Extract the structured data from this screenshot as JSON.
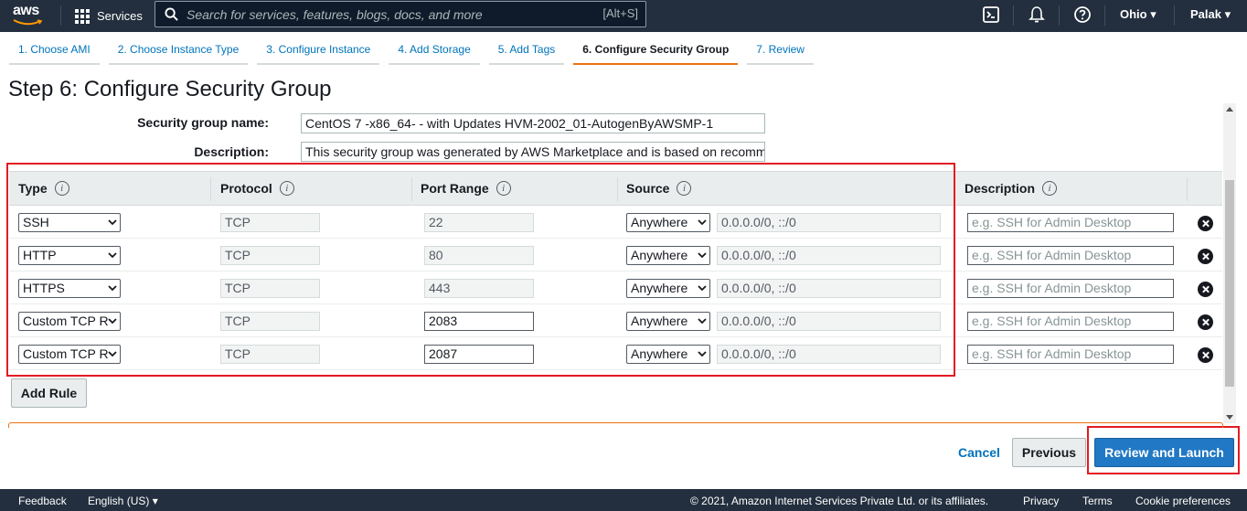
{
  "nav": {
    "logo": "aws",
    "services": "Services",
    "search_placeholder": "Search for services, features, blogs, docs, and more",
    "search_shortcut": "[Alt+S]",
    "region": "Ohio ▾",
    "user": "Palak ▾"
  },
  "steps": [
    {
      "label": "1. Choose AMI"
    },
    {
      "label": "2. Choose Instance Type"
    },
    {
      "label": "3. Configure Instance"
    },
    {
      "label": "4. Add Storage"
    },
    {
      "label": "5. Add Tags"
    },
    {
      "label": "6. Configure Security Group"
    },
    {
      "label": "7. Review"
    }
  ],
  "page_title": "Step 6: Configure Security Group",
  "form": {
    "sg_name_label": "Security group name:",
    "sg_name_value": "CentOS 7 -x86_64- - with Updates HVM-2002_01-AutogenByAWSMP-1",
    "desc_label": "Description:",
    "desc_value": "This security group was generated by AWS Marketplace and is based on recommended settings"
  },
  "table": {
    "headers": {
      "type": "Type",
      "protocol": "Protocol",
      "port_range": "Port Range",
      "source": "Source",
      "description": "Description"
    },
    "info_glyph": "i",
    "rows": [
      {
        "type": "SSH",
        "protocol": "TCP",
        "port": "22",
        "source": "Anywhere",
        "cidr": "0.0.0.0/0, ::/0",
        "desc_placeholder": "e.g. SSH for Admin Desktop"
      },
      {
        "type": "HTTP",
        "protocol": "TCP",
        "port": "80",
        "source": "Anywhere",
        "cidr": "0.0.0.0/0, ::/0",
        "desc_placeholder": "e.g. SSH for Admin Desktop"
      },
      {
        "type": "HTTPS",
        "protocol": "TCP",
        "port": "443",
        "source": "Anywhere",
        "cidr": "0.0.0.0/0, ::/0",
        "desc_placeholder": "e.g. SSH for Admin Desktop"
      },
      {
        "type": "Custom TCP R",
        "protocol": "TCP",
        "port": "2083",
        "source": "Anywhere",
        "cidr": "0.0.0.0/0, ::/0",
        "desc_placeholder": "e.g. SSH for Admin Desktop"
      },
      {
        "type": "Custom TCP R",
        "protocol": "TCP",
        "port": "2087",
        "source": "Anywhere",
        "cidr": "0.0.0.0/0, ::/0",
        "desc_placeholder": "e.g. SSH for Admin Desktop"
      }
    ]
  },
  "buttons": {
    "add_rule": "Add Rule",
    "cancel": "Cancel",
    "previous": "Previous",
    "review_launch": "Review and Launch"
  },
  "footer": {
    "feedback": "Feedback",
    "language": "English (US) ▾",
    "copyright": "© 2021, Amazon Internet Services Private Ltd. or its affiliates.",
    "privacy": "Privacy",
    "terms": "Terms",
    "cookies": "Cookie preferences"
  },
  "colors": {
    "nav_bg": "#232f3e",
    "accent_orange": "#ec7211",
    "link_blue": "#0073bb",
    "primary_button": "#2178c4",
    "highlight_red": "#e31b23"
  }
}
